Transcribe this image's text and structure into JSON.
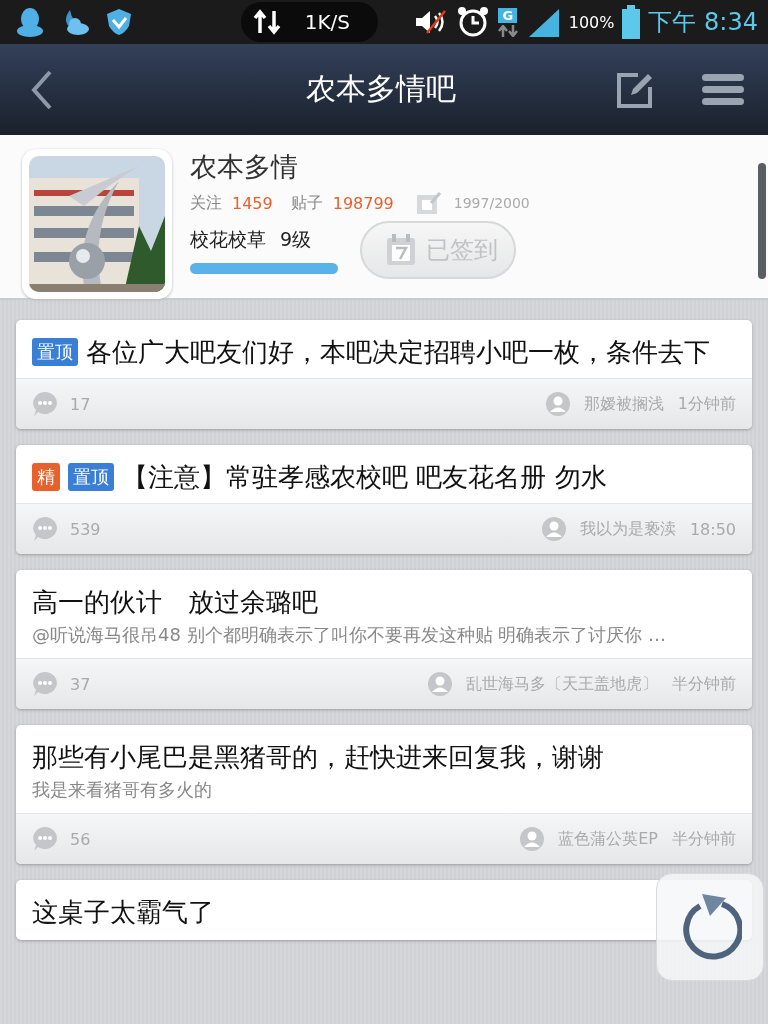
{
  "status_bar": {
    "speed": "1K/S",
    "battery": "100%",
    "time": "下午 8:34",
    "network": "G"
  },
  "nav": {
    "title": "农本多情吧"
  },
  "forum": {
    "name": "农本多情",
    "follow_label": "关注",
    "follow_count": "1459",
    "posts_label": "贴子",
    "posts_count": "198799",
    "sign_count": "1997/2000",
    "rank": "校花校草",
    "level_text": "9级",
    "sign_button": {
      "label": "已签到",
      "signed": true
    }
  },
  "posts": [
    {
      "tags": [
        {
          "label": "置顶",
          "color": "#3a7fd5"
        }
      ],
      "title": "各位广大吧友们好，本吧决定招聘小吧一枚，条件去下",
      "replies": "17",
      "author": "那嫒被搁浅",
      "time": "1分钟前"
    },
    {
      "tags": [
        {
          "label": "精",
          "color": "#e8602c"
        },
        {
          "label": "置顶",
          "color": "#3a7fd5"
        }
      ],
      "title": "【注意】常驻孝感农校吧 吧友花名册 勿水",
      "replies": "539",
      "author": "我以为是亵渎",
      "time": "18:50"
    },
    {
      "title": "高一的伙计　放过余璐吧",
      "summary": "@听说海马很吊48 别个都明确表示了叫你不要再发这种贴 明确表示了讨厌你 …",
      "replies": "37",
      "author": "乱世海马多〔天王盖地虎〕",
      "time": "半分钟前"
    },
    {
      "title": "那些有小尾巴是黑猪哥的，赶快进来回复我，谢谢",
      "summary": "我是来看猪哥有多火的",
      "replies": "56",
      "author": "蓝色蒲公英EP",
      "time": "半分钟前"
    },
    {
      "title": "这桌子太霸气了"
    }
  ]
}
